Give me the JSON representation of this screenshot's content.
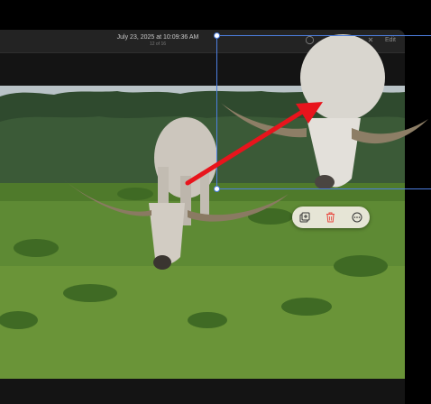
{
  "window": {
    "title_date": "July 23, 2025 at 10:09:36 AM",
    "title_count": "12 of 16",
    "edit_label": "Edit"
  },
  "icons": {
    "rotate": "rotate-icon",
    "close": "close-icon",
    "info": "info-icon"
  },
  "popover": {
    "actions": [
      "duplicate",
      "delete",
      "more"
    ]
  },
  "colors": {
    "selection": "#4d7fe0",
    "arrow": "#e8141c",
    "popover_bg": "#e6e5d6",
    "delete": "#e8453c"
  }
}
